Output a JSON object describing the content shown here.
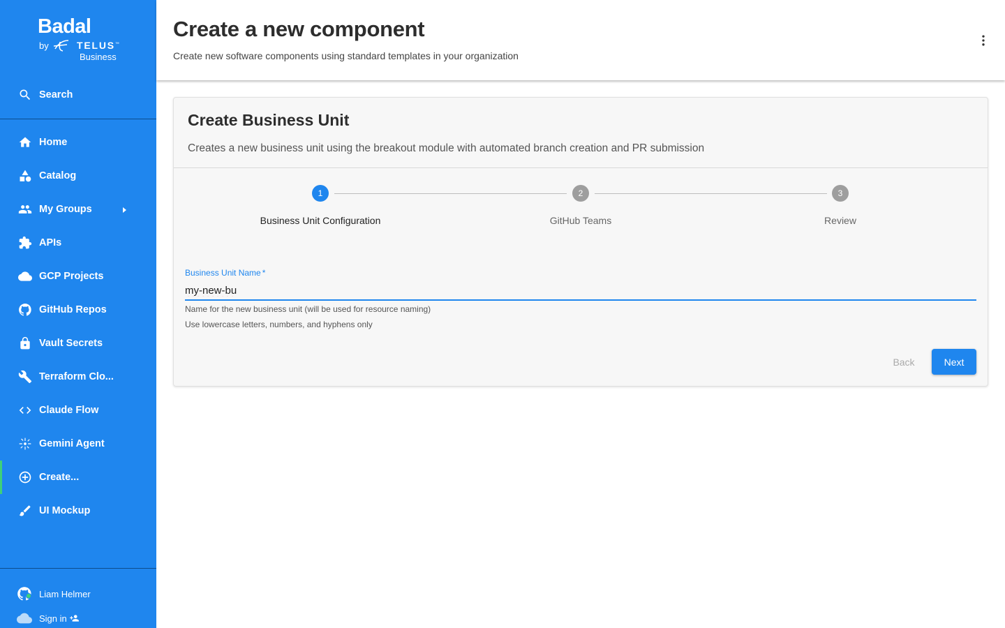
{
  "brand": {
    "title": "Badal",
    "by": "by",
    "telus": "TELUS",
    "business": "Business"
  },
  "sidebar": {
    "search_label": "Search",
    "items": [
      {
        "label": "Home",
        "icon": "home-icon"
      },
      {
        "label": "Catalog",
        "icon": "category-icon"
      },
      {
        "label": "My Groups",
        "icon": "people-icon"
      },
      {
        "label": "APIs",
        "icon": "extension-icon"
      },
      {
        "label": "GCP Projects",
        "icon": "cloud-icon"
      },
      {
        "label": "GitHub Repos",
        "icon": "github-icon"
      },
      {
        "label": "Vault Secrets",
        "icon": "lock-icon"
      },
      {
        "label": "Terraform Clo...",
        "icon": "wrench-icon"
      },
      {
        "label": "Claude Flow",
        "icon": "code-icon"
      },
      {
        "label": "Gemini Agent",
        "icon": "sparkle-icon"
      },
      {
        "label": "Create...",
        "icon": "add-circle-icon"
      },
      {
        "label": "UI Mockup",
        "icon": "brush-icon"
      }
    ],
    "user_name": "Liam Helmer",
    "sign_in": "Sign in"
  },
  "header": {
    "title": "Create a new component",
    "subtitle": "Create new software components using standard templates in your organization"
  },
  "card": {
    "title": "Create Business Unit",
    "subtitle": "Creates a new business unit using the breakout module with automated branch creation and PR submission",
    "steps": [
      {
        "number": "1",
        "label": "Business Unit Configuration",
        "state": "active"
      },
      {
        "number": "2",
        "label": "GitHub Teams",
        "state": "inactive"
      },
      {
        "number": "3",
        "label": "Review",
        "state": "inactive"
      }
    ],
    "field": {
      "label": "Business Unit Name",
      "required_mark": "*",
      "value": "my-new-bu",
      "helper_1": "Name for the new business unit (will be used for resource naming)",
      "helper_2": "Use lowercase letters, numbers, and hyphens only"
    },
    "back_label": "Back",
    "next_label": "Next"
  },
  "colors": {
    "sidebar_bg": "#1f86ee",
    "accent": "#1f86ee",
    "active_indicator": "#3fd07a",
    "step_inactive": "#9e9e9e"
  }
}
